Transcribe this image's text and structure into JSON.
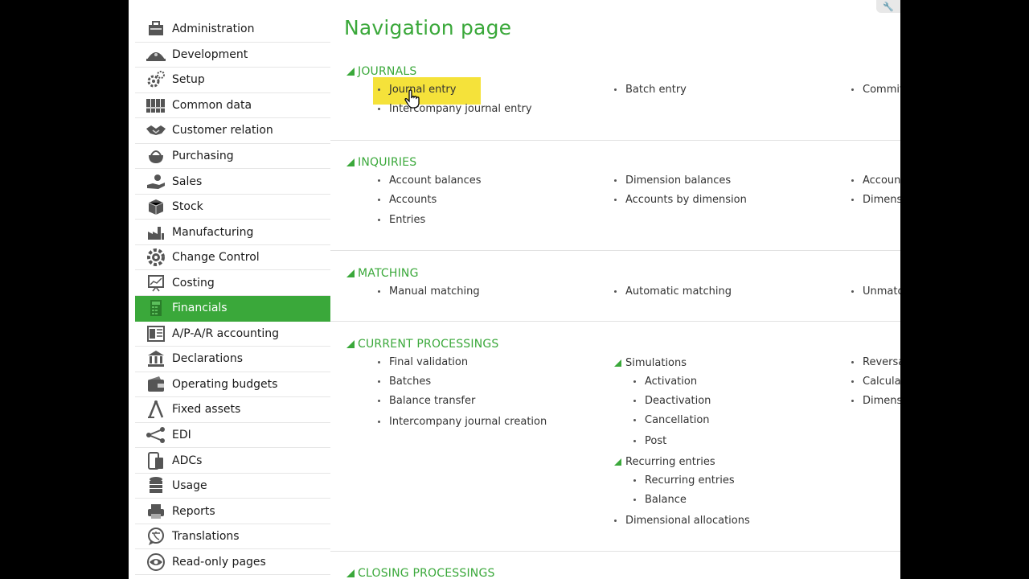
{
  "sidebar": {
    "items": [
      {
        "label": "Administration",
        "icon": "admin-icon"
      },
      {
        "label": "Development",
        "icon": "development-icon"
      },
      {
        "label": "Setup",
        "icon": "gears-icon"
      },
      {
        "label": "Common data",
        "icon": "binders-icon"
      },
      {
        "label": "Customer relation",
        "icon": "handshake-icon"
      },
      {
        "label": "Purchasing",
        "icon": "purse-icon"
      },
      {
        "label": "Sales",
        "icon": "hand-coin-icon"
      },
      {
        "label": "Stock",
        "icon": "box-icon"
      },
      {
        "label": "Manufacturing",
        "icon": "factory-icon"
      },
      {
        "label": "Change Control",
        "icon": "cog-icon"
      },
      {
        "label": "Costing",
        "icon": "chart-board-icon"
      },
      {
        "label": "Financials",
        "icon": "calculator-icon",
        "active": true
      },
      {
        "label": "A/P-A/R accounting",
        "icon": "ledger-icon"
      },
      {
        "label": "Declarations",
        "icon": "bank-icon"
      },
      {
        "label": "Operating budgets",
        "icon": "wallet-icon"
      },
      {
        "label": "Fixed assets",
        "icon": "compass-icon"
      },
      {
        "label": "EDI",
        "icon": "network-icon"
      },
      {
        "label": "ADCs",
        "icon": "devices-icon"
      },
      {
        "label": "Usage",
        "icon": "database-icon"
      },
      {
        "label": "Reports",
        "icon": "printer-icon"
      },
      {
        "label": "Translations",
        "icon": "translate-icon"
      },
      {
        "label": "Read-only pages",
        "icon": "eye-icon"
      }
    ]
  },
  "main": {
    "title": "Navigation page",
    "sections": {
      "journals": {
        "title": "JOURNALS",
        "links": [
          "Journal entry",
          "Intercompany journal entry",
          "Batch entry",
          "Commit"
        ]
      },
      "inquiries": {
        "title": "INQUIRIES",
        "links": [
          "Account balances",
          "Accounts",
          "Entries",
          "Dimension balances",
          "Accounts by dimension",
          "Accoun",
          "Dimens"
        ]
      },
      "matching": {
        "title": "MATCHING",
        "links": [
          "Manual matching",
          "Automatic matching",
          "Unmatc"
        ]
      },
      "current": {
        "title": "CURRENT PROCESSINGS",
        "links": [
          "Final validation",
          "Batches",
          "Balance transfer",
          "Intercompany journal creation"
        ],
        "simulations": {
          "label": "Simulations",
          "links": [
            "Activation",
            "Deactivation",
            "Cancellation",
            "Post"
          ]
        },
        "recurring": {
          "label": "Recurring entries",
          "links": [
            "Recurring entries",
            "Balance"
          ]
        },
        "dimensional": "Dimensional allocations",
        "right": [
          "Reversa",
          "Calculat",
          "Dimens"
        ]
      },
      "closing": {
        "title": "CLOSING PROCESSINGS"
      }
    }
  },
  "colors": {
    "accent": "#3aa83a",
    "highlight": "#f5e23a"
  }
}
